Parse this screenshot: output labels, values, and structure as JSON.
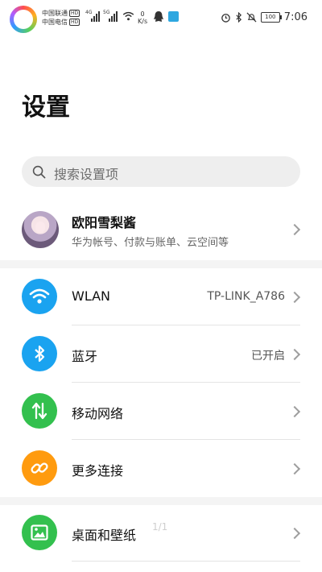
{
  "status_bar": {
    "carrier_1": "中国联通",
    "carrier_2": "中国电信",
    "hd": "HD",
    "net_1": "4G",
    "net_2": "5G",
    "speed_value": "0",
    "speed_unit": "K/s",
    "battery": "100",
    "time": "7:06"
  },
  "page": {
    "title": "设置"
  },
  "search": {
    "placeholder": "搜索设置项"
  },
  "profile": {
    "name": "欧阳雪梨酱",
    "subtitle": "华为帐号、付款与账单、云空间等"
  },
  "settings": [
    {
      "label": "WLAN",
      "value": "TP-LINK_A786",
      "icon": "wifi-icon",
      "color": "#1aa3f0"
    },
    {
      "label": "蓝牙",
      "value": "已开启",
      "icon": "bluetooth-icon",
      "color": "#1aa3f0"
    },
    {
      "label": "移动网络",
      "value": "",
      "icon": "mobile-data-icon",
      "color": "#33c04e"
    },
    {
      "label": "更多连接",
      "value": "",
      "icon": "link-icon",
      "color": "#ff9b0f"
    },
    {
      "label": "桌面和壁纸",
      "value": "",
      "icon": "wallpaper-icon",
      "color": "#33c04e"
    }
  ],
  "page_indicator": "1/1"
}
